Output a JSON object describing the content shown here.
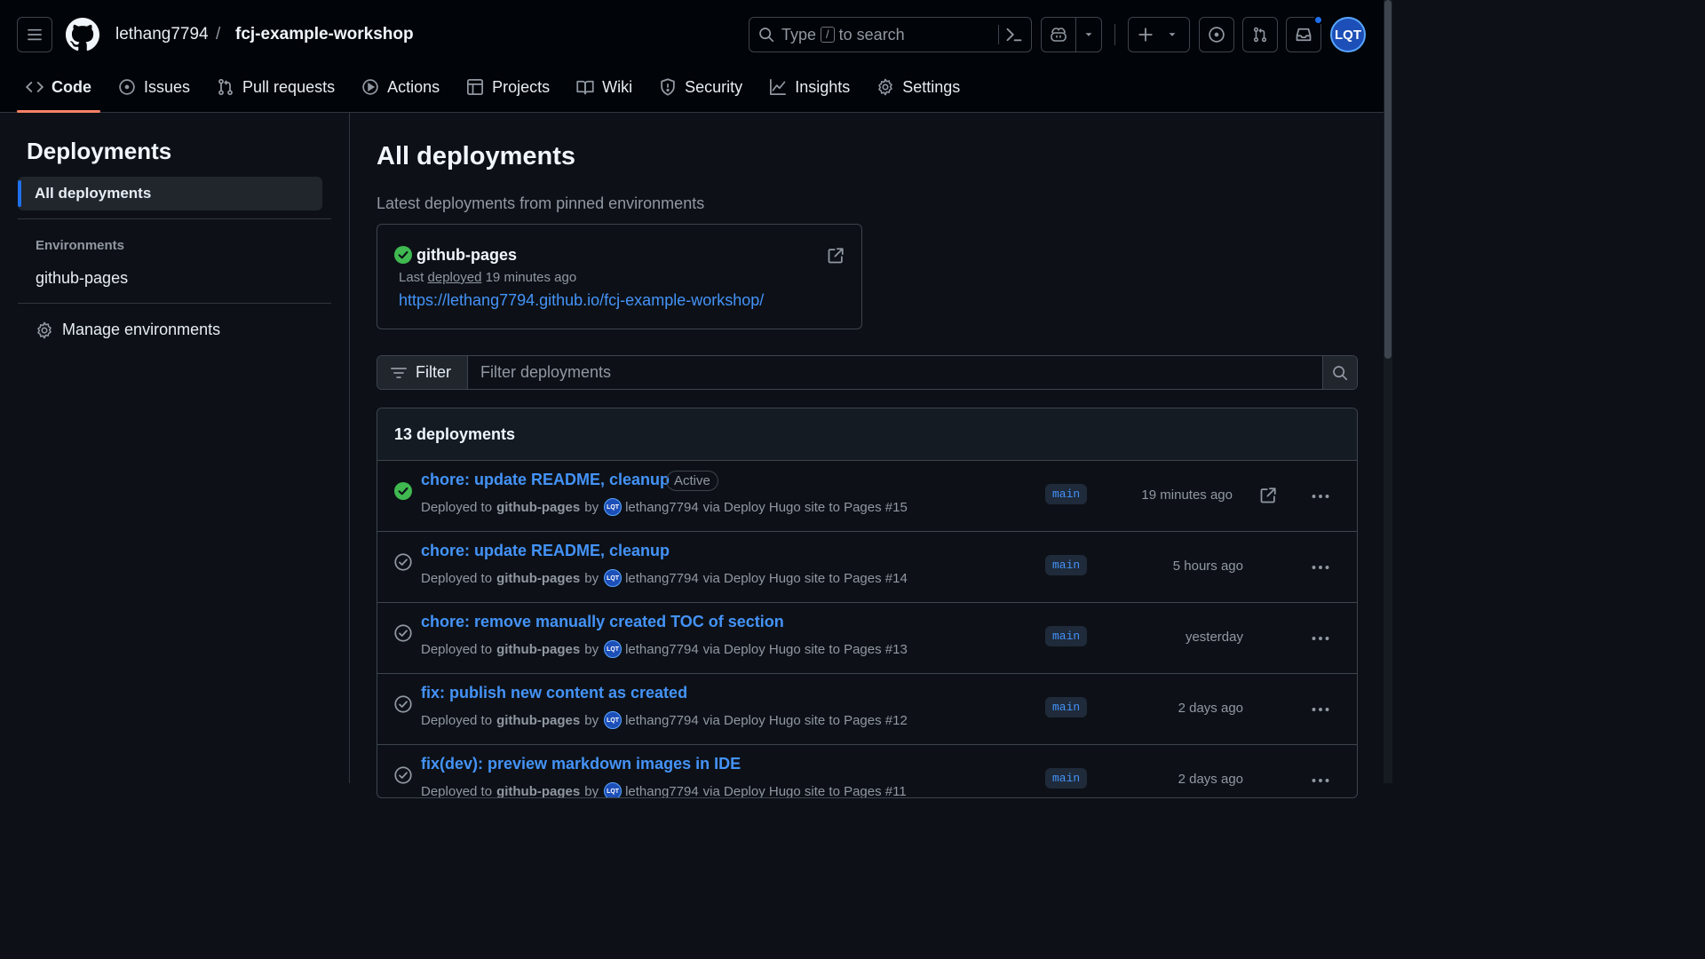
{
  "header": {
    "owner": "lethang7794",
    "separator": "/",
    "repo": "fcj-example-workshop",
    "search": {
      "prefix": "Type",
      "key": "/",
      "suffix": "to search"
    },
    "avatar_initials": "LQT"
  },
  "tabs": [
    {
      "label": "Code",
      "icon": "code-icon",
      "active": true
    },
    {
      "label": "Issues",
      "icon": "issue-opened-icon"
    },
    {
      "label": "Pull requests",
      "icon": "git-pull-request-icon"
    },
    {
      "label": "Actions",
      "icon": "play-icon"
    },
    {
      "label": "Projects",
      "icon": "table-icon"
    },
    {
      "label": "Wiki",
      "icon": "book-icon"
    },
    {
      "label": "Security",
      "icon": "shield-icon"
    },
    {
      "label": "Insights",
      "icon": "graph-icon"
    },
    {
      "label": "Settings",
      "icon": "gear-icon"
    }
  ],
  "sidebar": {
    "title": "Deployments",
    "active_item": "All deployments",
    "env_heading": "Environments",
    "env_item": "github-pages",
    "manage": "Manage environments"
  },
  "main": {
    "title": "All deployments",
    "subtitle": "Latest deployments from pinned environments",
    "pinned": {
      "name": "github-pages",
      "last_prefix": "Last",
      "last_link": "deployed",
      "last_time": "19 minutes ago",
      "url": "https://lethang7794.github.io/fcj-example-workshop/"
    },
    "filter": {
      "button": "Filter",
      "placeholder": "Filter deployments"
    },
    "count_label": "13 deployments",
    "deployments": [
      {
        "title": "chore: update README, cleanup",
        "badge": "Active",
        "active": true,
        "env": "github-pages",
        "author": "lethang7794",
        "avatar": "LQT",
        "workflow": "via Deploy Hugo site to Pages #15",
        "ref": "main",
        "when": "19 minutes ago"
      },
      {
        "title": "chore: update README, cleanup",
        "env": "github-pages",
        "author": "lethang7794",
        "avatar": "LQT",
        "workflow": "via Deploy Hugo site to Pages #14",
        "ref": "main",
        "when": "5 hours ago"
      },
      {
        "title": "chore: remove manually created TOC of section",
        "env": "github-pages",
        "author": "lethang7794",
        "avatar": "LQT",
        "workflow": "via Deploy Hugo site to Pages #13",
        "ref": "main",
        "when": "yesterday"
      },
      {
        "title": "fix: publish new content as created",
        "env": "github-pages",
        "author": "lethang7794",
        "avatar": "LQT",
        "workflow": "via Deploy Hugo site to Pages #12",
        "ref": "main",
        "when": "2 days ago"
      },
      {
        "title": "fix(dev): preview markdown images in IDE",
        "env": "github-pages",
        "author": "lethang7794",
        "avatar": "LQT",
        "workflow": "via Deploy Hugo site to Pages #11",
        "ref": "main",
        "when": "2 days ago"
      }
    ],
    "deployed_to_label": "Deployed to",
    "by_label": "by"
  },
  "colors": {
    "bg": "#0d1117",
    "header_bg": "#010409",
    "accent_link": "#4493f8",
    "success": "#3fb950",
    "active_tab_underline": "#f78166"
  }
}
